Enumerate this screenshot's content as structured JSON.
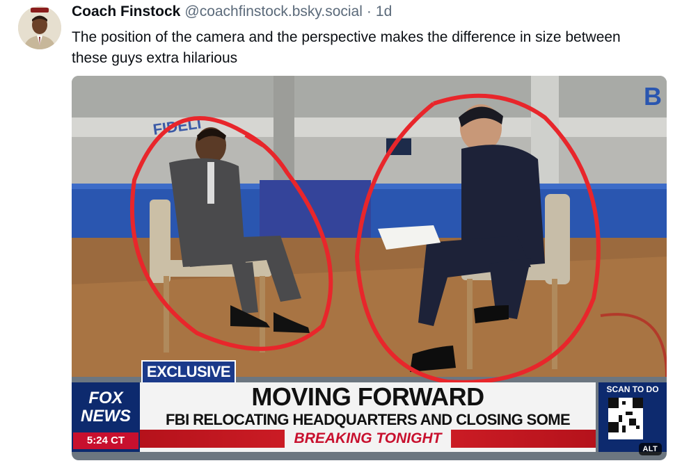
{
  "post": {
    "author_display_name": "Coach Finstock",
    "author_handle": "@coachfinstock.bsky.social",
    "separator": "·",
    "timestamp": "1d",
    "text": "The position of the camera and the perspective makes the difference in size between these guys extra hilarious",
    "avatar_icon": "avatar-photo-icon"
  },
  "media": {
    "alt_badge": "ALT",
    "chyron": {
      "exclusive": "EXCLUSIVE",
      "network": "FOX NEWS",
      "time": "5:24 CT",
      "headline": "MOVING FORWARD",
      "subheadline": "FBI RELOCATING HEADQUARTERS AND CLOSING SOME OFFICES",
      "breaking": "BREAKING TONIGHT",
      "scan": "SCAN TO DO"
    },
    "scene_text": {
      "wall_sign": "FIDELI",
      "wall_letter": "B"
    },
    "colors": {
      "circle_red": "#e8262b",
      "fox_blue": "#0d2a6e",
      "breaking_red": "#c8102e"
    }
  }
}
